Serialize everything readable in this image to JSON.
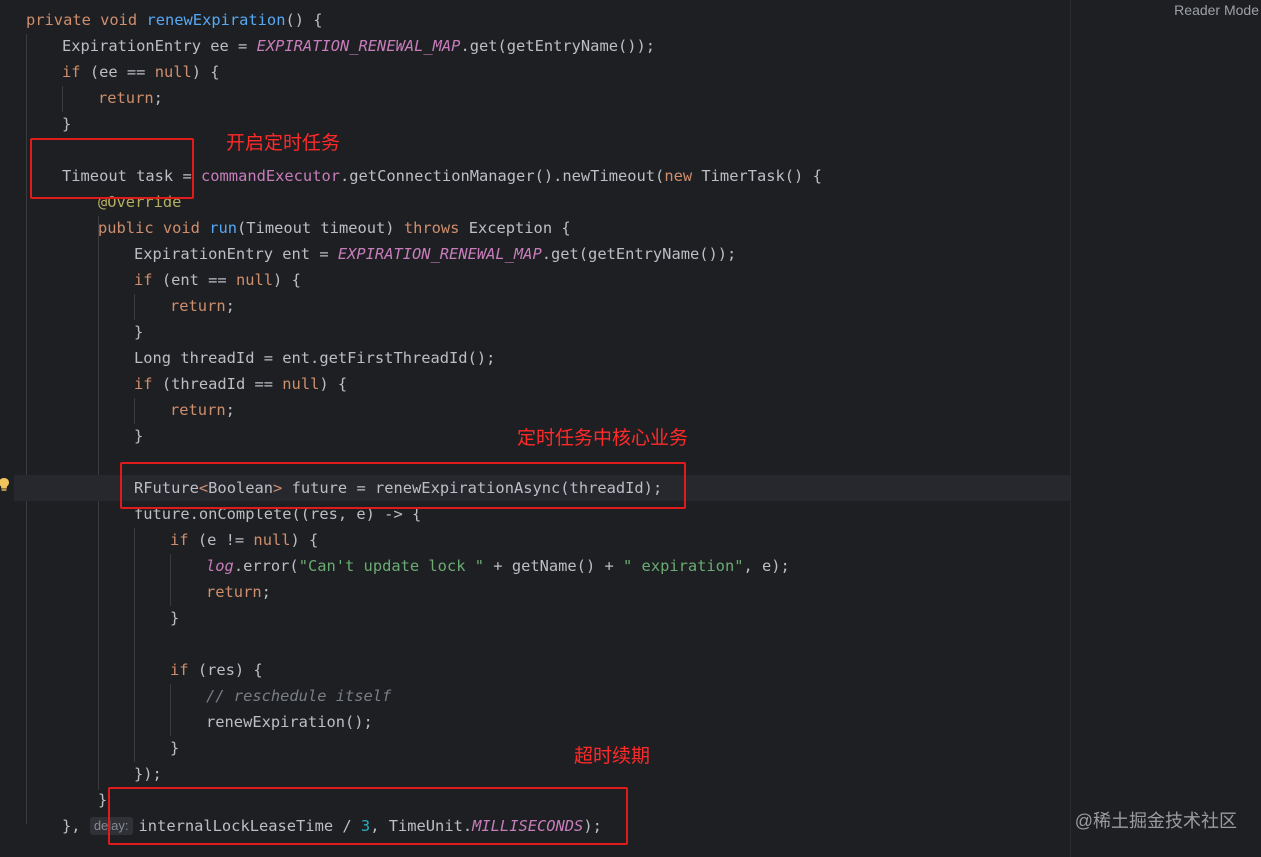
{
  "header": {
    "reader_mode": "Reader Mode"
  },
  "code": {
    "l1": {
      "kw": "private void ",
      "fn": "renewExpiration",
      "rest": "() {"
    },
    "l2": {
      "a": "ExpirationEntry ee = ",
      "const": "EXPIRATION_RENEWAL_MAP",
      "b": ".get(getEntryName());"
    },
    "l3": {
      "kw": "if",
      "a": " (ee == ",
      "kw2": "null",
      "b": ") {"
    },
    "l4": {
      "kw": "return",
      "a": ";"
    },
    "l5": {
      "a": "}"
    },
    "l7": {
      "a": "Timeout task = ",
      "field": "commandExecutor",
      "b": ".getConnectionManager().newTimeout(",
      "kw": "new",
      "c": " TimerTask() {"
    },
    "l8": {
      "anno": "@Override"
    },
    "l9": {
      "kw": "public void ",
      "fn": "run",
      "a": "(Timeout timeout) ",
      "kw2": "throws",
      "b": " Exception {"
    },
    "l10": {
      "a": "ExpirationEntry ent = ",
      "const": "EXPIRATION_RENEWAL_MAP",
      "b": ".get(getEntryName());"
    },
    "l11": {
      "kw": "if",
      "a": " (ent == ",
      "kw2": "null",
      "b": ") {"
    },
    "l12": {
      "kw": "return",
      "a": ";"
    },
    "l13": {
      "a": "}"
    },
    "l14": {
      "a": "Long threadId = ent.getFirstThreadId();"
    },
    "l15": {
      "kw": "if",
      "a": " (threadId == ",
      "kw2": "null",
      "b": ") {"
    },
    "l16": {
      "kw": "return",
      "a": ";"
    },
    "l17": {
      "a": "}"
    },
    "l19": {
      "a": "RFuture",
      "lt": "<",
      "b": "Boolean",
      "gt": ">",
      "c": " future = renewExpirationAsync(threadId);"
    },
    "l20": {
      "a": "future.onComplete((res, e) -> {"
    },
    "l21": {
      "kw": "if",
      "a": " (e != ",
      "kw2": "null",
      "b": ") {"
    },
    "l22": {
      "log": "log",
      "a": ".error(",
      "str1": "\"Can't update lock \"",
      "b": " + getName() + ",
      "str2": "\" expiration\"",
      "c": ", e);"
    },
    "l23": {
      "kw": "return",
      "a": ";"
    },
    "l24": {
      "a": "}"
    },
    "l26": {
      "kw": "if",
      "a": " (res) {"
    },
    "l27": {
      "cmt": "// reschedule itself"
    },
    "l28": {
      "a": "renewExpiration();"
    },
    "l29": {
      "a": "}"
    },
    "l30": {
      "a": "});"
    },
    "l31": {
      "a": "}"
    },
    "l32": {
      "a": "}, ",
      "hint": "delay:",
      "b": "internalLockLeaseTime / ",
      "num": "3",
      "c": ", TimeUnit.",
      "const": "MILLISECONDS",
      "d": ");"
    }
  },
  "annotations": {
    "a1": "开启定时任务",
    "a2": "定时任务中核心业务",
    "a3": "超时续期"
  },
  "watermark": "@稀土掘金技术社区",
  "colors": {
    "background": "#1e1f22",
    "keyword": "#cf8e6d",
    "function": "#56a8f5",
    "constant": "#c77dbb",
    "string": "#6aab73",
    "annotation_box": "#e01b1b"
  }
}
